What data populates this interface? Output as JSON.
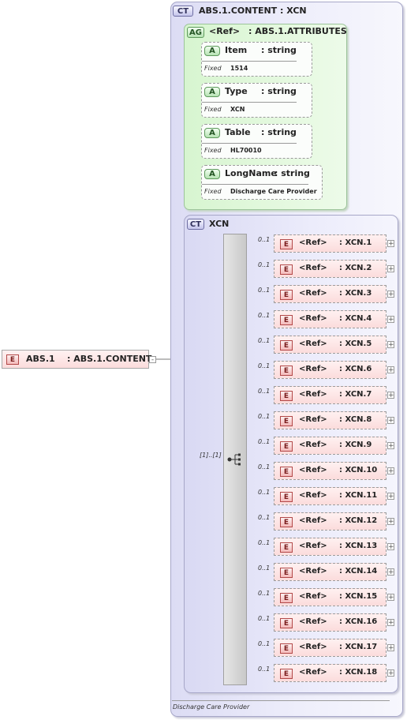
{
  "root_element": {
    "badge": "E",
    "name": "ABS.1",
    "type": ": ABS.1.CONTENT",
    "collapse": "-"
  },
  "outer_type": {
    "badge": "CT",
    "title": "ABS.1.CONTENT : XCN",
    "documentation": "Discharge Care Provider"
  },
  "attribute_group": {
    "badge": "AG",
    "ref": "<Ref>",
    "name": ": ABS.1.ATTRIBUTES",
    "attributes": [
      {
        "badge": "A",
        "name": "Item",
        "type": ": string",
        "fixed_label": "Fixed",
        "fixed_value": "1514"
      },
      {
        "badge": "A",
        "name": "Type",
        "type": ": string",
        "fixed_label": "Fixed",
        "fixed_value": "XCN"
      },
      {
        "badge": "A",
        "name": "Table",
        "type": ": string",
        "fixed_label": "Fixed",
        "fixed_value": "HL70010"
      },
      {
        "badge": "A",
        "name": "LongName",
        "type": ": string",
        "fixed_label": "Fixed",
        "fixed_value": "Discharge Care Provider"
      }
    ]
  },
  "inner_type": {
    "badge": "CT",
    "title": "XCN",
    "sequence_cardinality": "[1]..[1]",
    "elements": [
      {
        "badge": "E",
        "ref": "<Ref>",
        "name": ": XCN.1",
        "card": "0..1",
        "expand": "+"
      },
      {
        "badge": "E",
        "ref": "<Ref>",
        "name": ": XCN.2",
        "card": "0..1",
        "expand": "+"
      },
      {
        "badge": "E",
        "ref": "<Ref>",
        "name": ": XCN.3",
        "card": "0..1",
        "expand": "+"
      },
      {
        "badge": "E",
        "ref": "<Ref>",
        "name": ": XCN.4",
        "card": "0..1",
        "expand": "+"
      },
      {
        "badge": "E",
        "ref": "<Ref>",
        "name": ": XCN.5",
        "card": "0..1",
        "expand": "+"
      },
      {
        "badge": "E",
        "ref": "<Ref>",
        "name": ": XCN.6",
        "card": "0..1",
        "expand": "+"
      },
      {
        "badge": "E",
        "ref": "<Ref>",
        "name": ": XCN.7",
        "card": "0..1",
        "expand": "+"
      },
      {
        "badge": "E",
        "ref": "<Ref>",
        "name": ": XCN.8",
        "card": "0..1",
        "expand": "+"
      },
      {
        "badge": "E",
        "ref": "<Ref>",
        "name": ": XCN.9",
        "card": "0..1",
        "expand": "+"
      },
      {
        "badge": "E",
        "ref": "<Ref>",
        "name": ": XCN.10",
        "card": "0..1",
        "expand": "+"
      },
      {
        "badge": "E",
        "ref": "<Ref>",
        "name": ": XCN.11",
        "card": "0..1",
        "expand": "+"
      },
      {
        "badge": "E",
        "ref": "<Ref>",
        "name": ": XCN.12",
        "card": "0..1",
        "expand": "+"
      },
      {
        "badge": "E",
        "ref": "<Ref>",
        "name": ": XCN.13",
        "card": "0..1",
        "expand": "+"
      },
      {
        "badge": "E",
        "ref": "<Ref>",
        "name": ": XCN.14",
        "card": "0..1",
        "expand": "+"
      },
      {
        "badge": "E",
        "ref": "<Ref>",
        "name": ": XCN.15",
        "card": "0..1",
        "expand": "+"
      },
      {
        "badge": "E",
        "ref": "<Ref>",
        "name": ": XCN.16",
        "card": "0..1",
        "expand": "+"
      },
      {
        "badge": "E",
        "ref": "<Ref>",
        "name": ": XCN.17",
        "card": "0..1",
        "expand": "+"
      },
      {
        "badge": "E",
        "ref": "<Ref>",
        "name": ": XCN.18",
        "card": "0..1",
        "expand": "+"
      }
    ]
  },
  "icons": {
    "sequence": "sequence-compositor-icon"
  }
}
